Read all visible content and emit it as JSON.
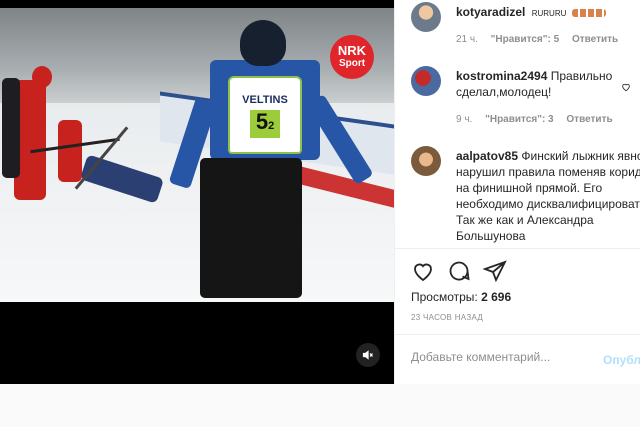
{
  "video": {
    "broadcaster_logo": {
      "line1": "NRK",
      "line2": "Sport",
      "color": "#e0262b"
    },
    "bib": {
      "sponsor": "VELTINS",
      "number": "5",
      "sub": "2"
    },
    "mute_icon": "speaker-muted-icon"
  },
  "post": {
    "author": "kotyaradizel",
    "caption_text": "RURURU",
    "caption_emoji_note": "",
    "author_meta": {
      "time": "21 ч.",
      "likes": "\"Нравится\": 5",
      "reply": "Ответить"
    }
  },
  "comments": [
    {
      "user": "kostromina2494",
      "text": "Правильно сделал,молодец!",
      "time": "9 ч.",
      "likes": "\"Нравится\": 3",
      "reply": "Ответить"
    },
    {
      "user": "aalpatov85",
      "text": "Финский лыжник явно нарушил правила поменяв коридор на финишной прямой. Его необходимо дисквалифицировать! Так же как и Александра Большунова"
    }
  ],
  "actions": {
    "like_icon": "heart-icon",
    "comment_icon": "comment-icon",
    "share_icon": "share-icon"
  },
  "views": {
    "label": "Просмотры:",
    "value": "2 696"
  },
  "timestamp": "23 ЧАСОВ НАЗАД",
  "add_comment": {
    "placeholder": "Добавьте комментарий...",
    "post_label": "Опубликовать"
  },
  "colors": {
    "link_blue": "#b2dffc",
    "meta_gray": "#8e8e8e",
    "text": "#262626"
  }
}
